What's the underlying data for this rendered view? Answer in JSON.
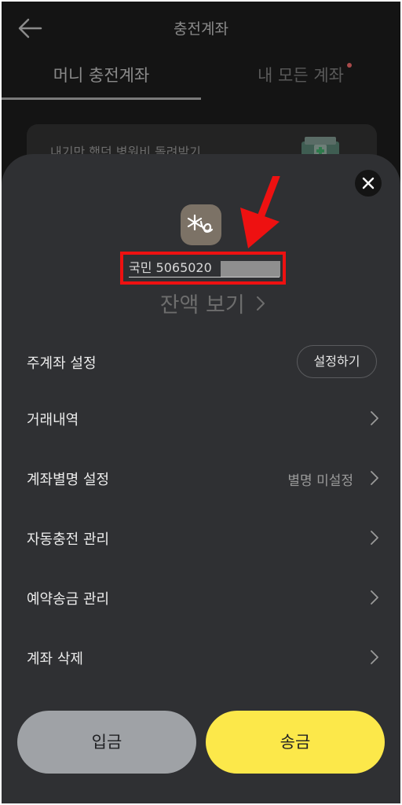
{
  "header": {
    "title": "충전계좌",
    "back_icon": "arrow-left-icon"
  },
  "tabs": [
    {
      "label": "머니 충전계좌",
      "active": true
    },
    {
      "label": "내 모든 계좌",
      "active": false,
      "has_dot": true
    }
  ],
  "banner": {
    "text": "내기만 했던 병원비 돌려받기",
    "icon": "hospital-icon"
  },
  "sheet": {
    "close_icon": "close-icon",
    "bank_logo_icon": "kb-star-logo-icon",
    "account_number": "국민 5065020",
    "balance_link": "잔액 보기",
    "menu": [
      {
        "label": "주계좌 설정",
        "button": "설정하기"
      },
      {
        "label": "거래내역"
      },
      {
        "label": "계좌별명 설정",
        "value": "별명 미설정"
      },
      {
        "label": "자동충전 관리"
      },
      {
        "label": "예약송금 관리"
      },
      {
        "label": "계좌 삭제"
      }
    ],
    "deposit_label": "입금",
    "transfer_label": "송금"
  },
  "colors": {
    "background": "#141414",
    "sheet": "#2f3033",
    "transfer_button": "#fce84a",
    "deposit_button": "#9fa2a6",
    "highlight_box": "#ee1111"
  }
}
